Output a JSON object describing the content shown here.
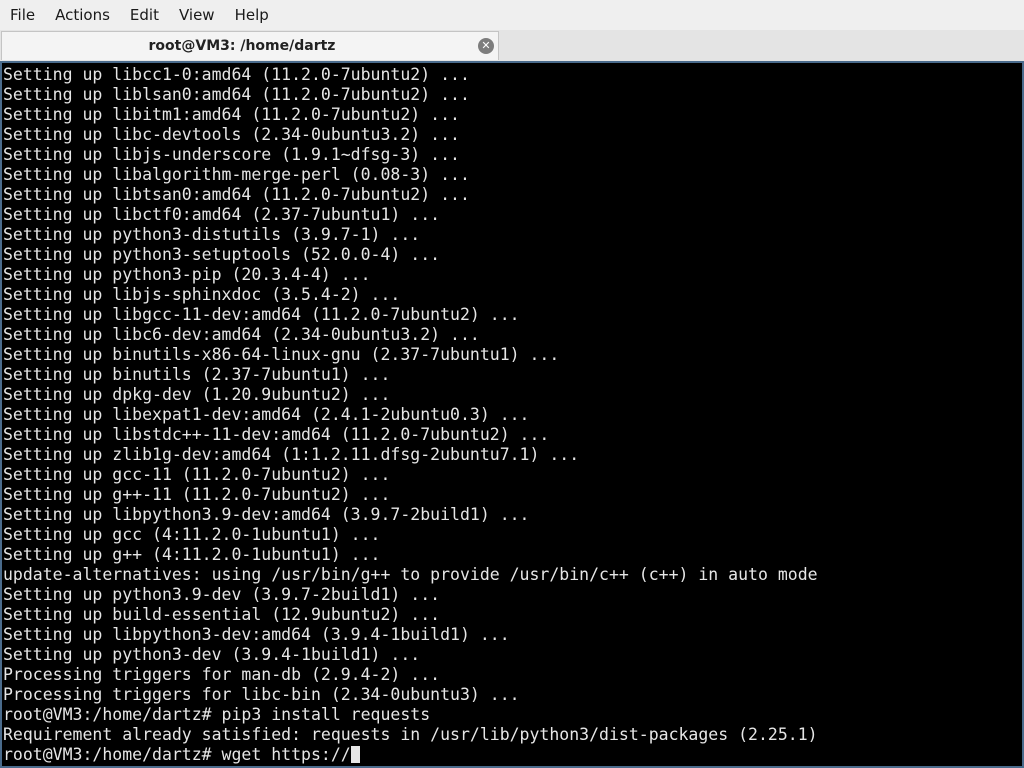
{
  "menubar": {
    "items": [
      {
        "label": "File"
      },
      {
        "label": "Actions"
      },
      {
        "label": "Edit"
      },
      {
        "label": "View"
      },
      {
        "label": "Help"
      }
    ]
  },
  "tab": {
    "title": "root@VM3: /home/dartz",
    "close_icon": "close-icon"
  },
  "terminal": {
    "lines": [
      "Setting up libcc1-0:amd64 (11.2.0-7ubuntu2) ...",
      "Setting up liblsan0:amd64 (11.2.0-7ubuntu2) ...",
      "Setting up libitm1:amd64 (11.2.0-7ubuntu2) ...",
      "Setting up libc-devtools (2.34-0ubuntu3.2) ...",
      "Setting up libjs-underscore (1.9.1~dfsg-3) ...",
      "Setting up libalgorithm-merge-perl (0.08-3) ...",
      "Setting up libtsan0:amd64 (11.2.0-7ubuntu2) ...",
      "Setting up libctf0:amd64 (2.37-7ubuntu1) ...",
      "Setting up python3-distutils (3.9.7-1) ...",
      "Setting up python3-setuptools (52.0.0-4) ...",
      "Setting up python3-pip (20.3.4-4) ...",
      "Setting up libjs-sphinxdoc (3.5.4-2) ...",
      "Setting up libgcc-11-dev:amd64 (11.2.0-7ubuntu2) ...",
      "Setting up libc6-dev:amd64 (2.34-0ubuntu3.2) ...",
      "Setting up binutils-x86-64-linux-gnu (2.37-7ubuntu1) ...",
      "Setting up binutils (2.37-7ubuntu1) ...",
      "Setting up dpkg-dev (1.20.9ubuntu2) ...",
      "Setting up libexpat1-dev:amd64 (2.4.1-2ubuntu0.3) ...",
      "Setting up libstdc++-11-dev:amd64 (11.2.0-7ubuntu2) ...",
      "Setting up zlib1g-dev:amd64 (1:1.2.11.dfsg-2ubuntu7.1) ...",
      "Setting up gcc-11 (11.2.0-7ubuntu2) ...",
      "Setting up g++-11 (11.2.0-7ubuntu2) ...",
      "Setting up libpython3.9-dev:amd64 (3.9.7-2build1) ...",
      "Setting up gcc (4:11.2.0-1ubuntu1) ...",
      "Setting up g++ (4:11.2.0-1ubuntu1) ...",
      "update-alternatives: using /usr/bin/g++ to provide /usr/bin/c++ (c++) in auto mode",
      "Setting up python3.9-dev (3.9.7-2build1) ...",
      "Setting up build-essential (12.9ubuntu2) ...",
      "Setting up libpython3-dev:amd64 (3.9.4-1build1) ...",
      "Setting up python3-dev (3.9.4-1build1) ...",
      "Processing triggers for man-db (2.9.4-2) ...",
      "Processing triggers for libc-bin (2.34-0ubuntu3) ...",
      "root@VM3:/home/dartz# pip3 install requests",
      "Requirement already satisfied: requests in /usr/lib/python3/dist-packages (2.25.1)"
    ],
    "prompt": "root@VM3:/home/dartz# ",
    "current_input": "wget https://"
  },
  "colors": {
    "terminal_bg": "#000000",
    "terminal_fg": "#e6e6e6",
    "terminal_border": "#4a6b8c",
    "chrome_bg": "#efefef"
  }
}
